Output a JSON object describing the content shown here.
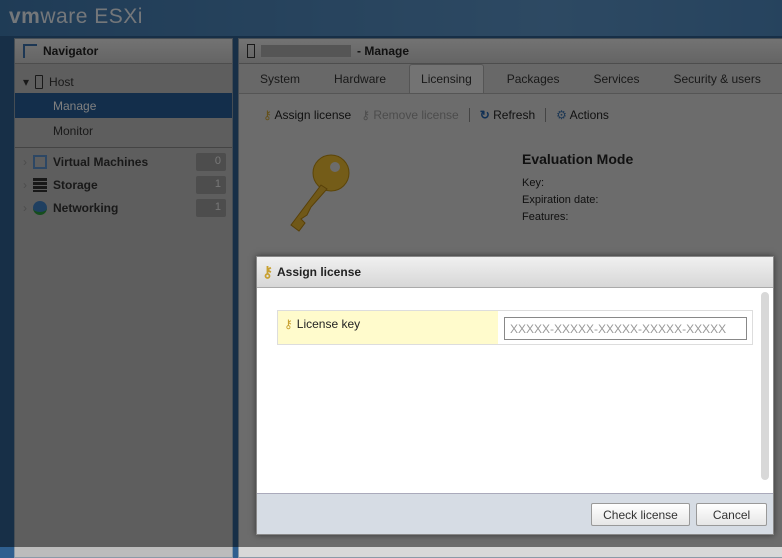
{
  "brand": {
    "vm": "vm",
    "ware": "ware",
    "product": "ESXi"
  },
  "navigator": {
    "title": "Navigator",
    "host": "Host",
    "items": [
      {
        "label": "Manage"
      },
      {
        "label": "Monitor"
      }
    ],
    "groups": [
      {
        "label": "Virtual Machines",
        "count": "0"
      },
      {
        "label": "Storage",
        "count": "1"
      },
      {
        "label": "Networking",
        "count": "1"
      }
    ]
  },
  "main": {
    "title": "- Manage",
    "tabs": [
      "System",
      "Hardware",
      "Licensing",
      "Packages",
      "Services",
      "Security & users"
    ],
    "toolbar": {
      "assign": "Assign license",
      "remove": "Remove license",
      "refresh": "Refresh",
      "actions": "Actions"
    },
    "license": {
      "mode": "Evaluation Mode",
      "key": "Key:",
      "expiration": "Expiration date:",
      "features": "Features:"
    }
  },
  "dialog": {
    "title": "Assign license",
    "label": "License key",
    "placeholder": "XXXXX-XXXXX-XXXXX-XXXXX-XXXXX",
    "check": "Check license",
    "cancel": "Cancel"
  }
}
